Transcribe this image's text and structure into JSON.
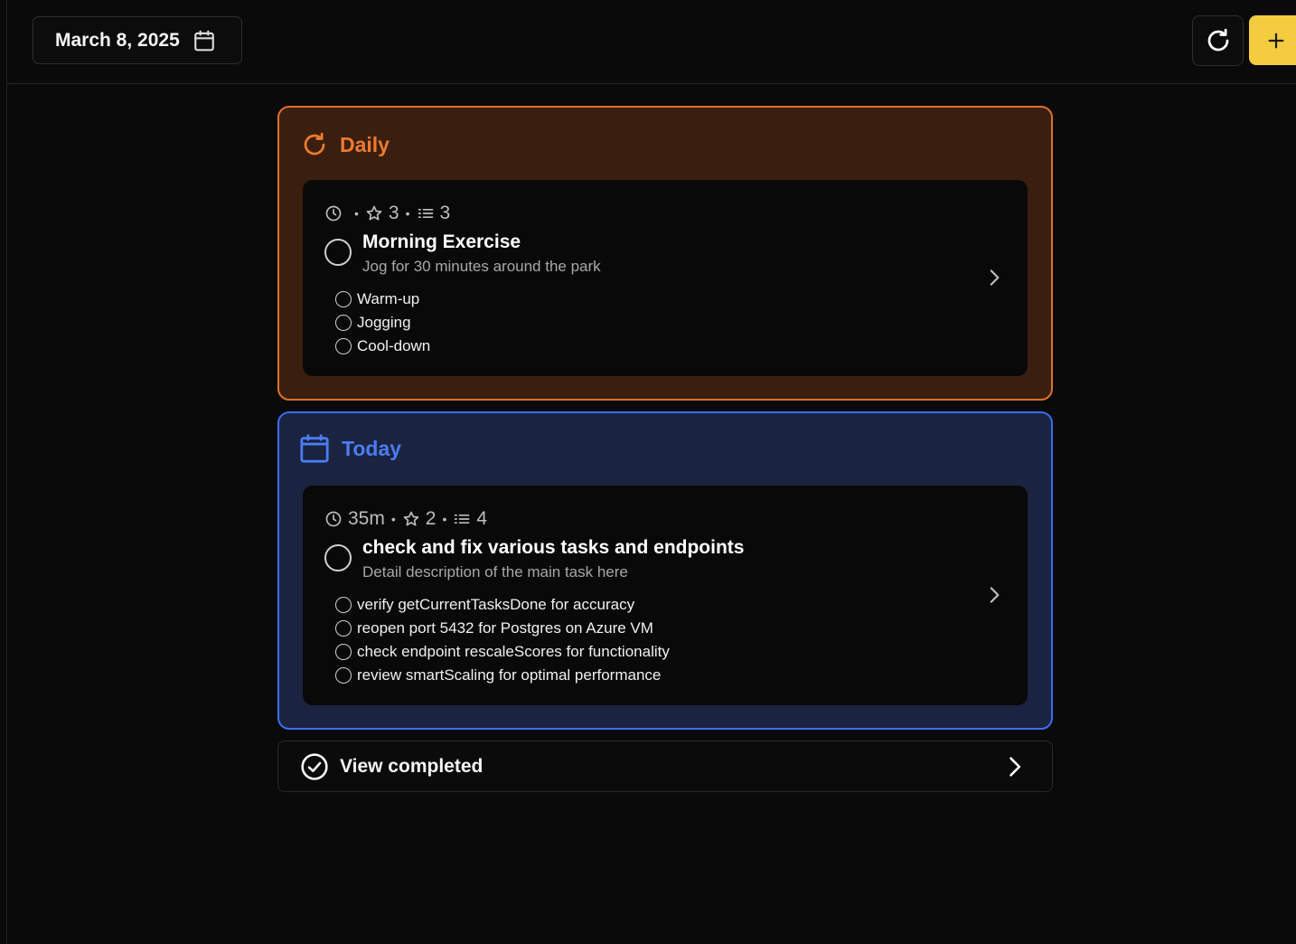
{
  "header": {
    "date_label": "March 8, 2025",
    "date_icon": "calendar-icon",
    "refresh_icon": "refresh-icon",
    "add_icon": "plus-icon"
  },
  "colors": {
    "daily_accent": "#ee7a30",
    "daily_bg": "#3a1f10",
    "today_accent": "#4a7df0",
    "today_bg": "#1a2340",
    "add_button": "#f3cd3f",
    "background": "#0a0a0a"
  },
  "sections": [
    {
      "title": "Daily",
      "icon": "repeat-icon",
      "tasks": [
        {
          "duration": "",
          "points": "3",
          "subtask_count": "3",
          "title": "Morning Exercise",
          "description": "Jog for 30 minutes around the park",
          "subtasks": [
            "Warm-up",
            "Jogging",
            "Cool-down"
          ]
        }
      ]
    },
    {
      "title": "Today",
      "icon": "calendar-icon",
      "tasks": [
        {
          "duration": "35m",
          "points": "2",
          "subtask_count": "4",
          "title": "check and fix various tasks and endpoints",
          "description": "Detail description of the main task here",
          "subtasks": [
            "verify getCurrentTasksDone for accuracy",
            "reopen port 5432 for Postgres on Azure VM",
            "check endpoint rescaleScores for functionality",
            "review smartScaling for optimal performance"
          ]
        }
      ]
    }
  ],
  "view_completed": {
    "label": "View completed",
    "icon": "check-circle-icon"
  }
}
